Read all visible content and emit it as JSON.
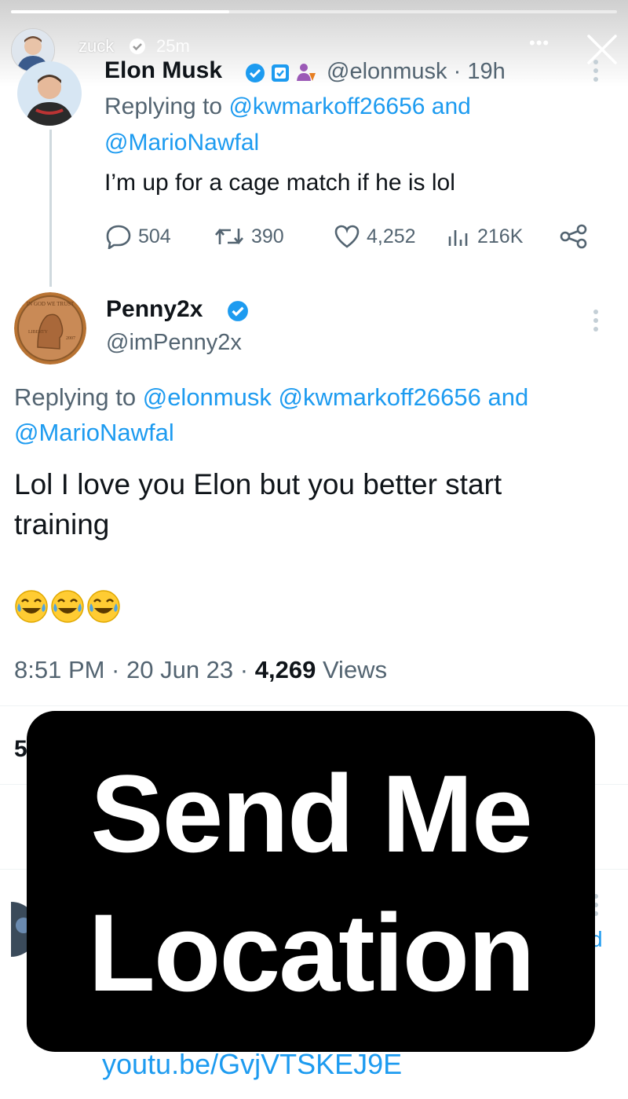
{
  "story": {
    "user": "zuck",
    "time_ago": "25m",
    "more_icon": "•••",
    "progress": 0.36
  },
  "reply_tweet": {
    "name": "Elon Musk",
    "handle_time": "@elonmusk · 19h",
    "replying_to_line1": "Replying to @kwmarkoff26656 and",
    "replying_to_line2": "@MarioNawfal",
    "body": "I’m up for a cage match if he is lol",
    "stats": {
      "replies": "504",
      "retweets": "390",
      "likes": "4,252",
      "views": "216K"
    }
  },
  "main_tweet": {
    "name": "Penny2x",
    "handle": "@imPenny2x",
    "replying_to_line1": "Replying to @elonmusk @kwmarkoff26656 and",
    "replying_to_line2": "@MarioNawfal",
    "body_line1": "Lol I love you Elon but you better start",
    "body_line2": "training",
    "emojis": "😂😂😂",
    "timestamp": "8:51 PM · 20 Jun 23 ·",
    "views_count": "4,269",
    "views_label": "Views"
  },
  "partial": {
    "stat_fragment": "5",
    "right_fragment": "d",
    "link_fragment": "youtu.be/GvjVTSKEJ9E"
  },
  "overlay": {
    "line1": "Send Me",
    "line2": "Location"
  },
  "colors": {
    "accent": "#1d9bf0",
    "text": "#0f1419",
    "muted": "#536471"
  }
}
